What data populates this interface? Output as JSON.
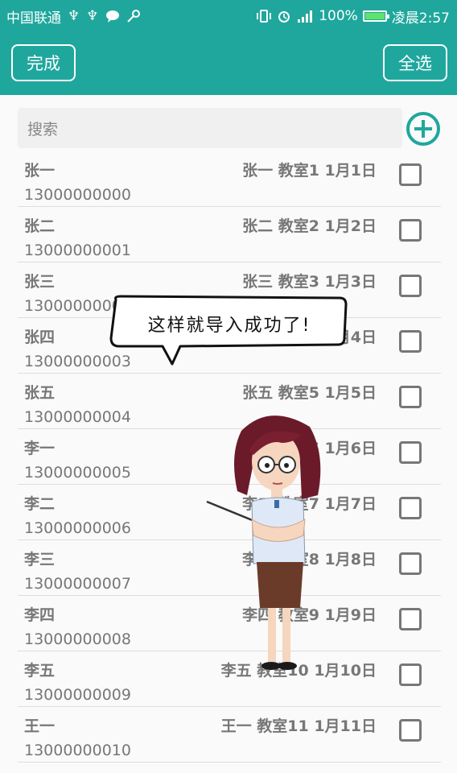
{
  "status_bar": {
    "carrier": "中国联通",
    "battery": "100%",
    "battery_level": 1.0,
    "time": "凌晨2:57"
  },
  "appbar": {
    "done_label": "完成",
    "select_all_label": "全选"
  },
  "search": {
    "placeholder": "搜索"
  },
  "items": [
    {
      "name": "张一",
      "phone": "13000000000",
      "info": "张一 教室1 1月1日"
    },
    {
      "name": "张二",
      "phone": "13000000001",
      "info": "张二 教室2 1月2日"
    },
    {
      "name": "张三",
      "phone": "13000000002",
      "info": "张三 教室3 1月3日"
    },
    {
      "name": "张四",
      "phone": "13000000003",
      "info": "张四 教室4 1月4日"
    },
    {
      "name": "张五",
      "phone": "13000000004",
      "info": "张五 教室5 1月5日"
    },
    {
      "name": "李一",
      "phone": "13000000005",
      "info": "李一 教室6 1月6日"
    },
    {
      "name": "李二",
      "phone": "13000000006",
      "info": "李二 教室7 1月7日"
    },
    {
      "name": "李三",
      "phone": "13000000007",
      "info": "李三 教室8 1月8日"
    },
    {
      "name": "李四",
      "phone": "13000000008",
      "info": "李四 教室9 1月9日"
    },
    {
      "name": "李五",
      "phone": "13000000009",
      "info": "李五 教室10 1月10日"
    },
    {
      "name": "王一",
      "phone": "13000000010",
      "info": "王一 教室11 1月11日"
    }
  ],
  "overlay": {
    "bubble_text": "这样就导入成功了!"
  },
  "colors": {
    "primary": "#1fa79d",
    "text": "#777777"
  }
}
